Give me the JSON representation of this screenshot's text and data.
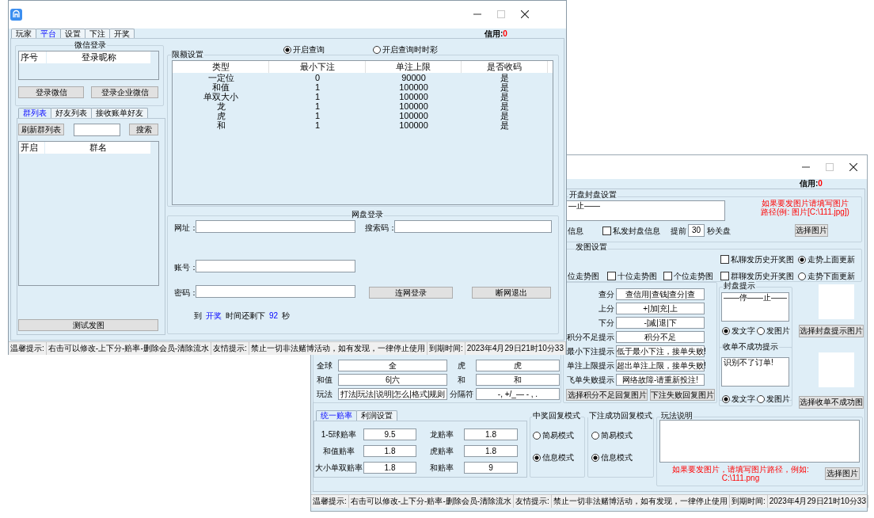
{
  "window_main": {
    "credit_label": "信用:",
    "credit_value": "0",
    "tabs": [
      {
        "label": "玩家",
        "selected": false
      },
      {
        "label": "平台",
        "selected": true
      },
      {
        "label": "设置",
        "selected": false
      },
      {
        "label": "下注",
        "selected": false
      },
      {
        "label": "开奖",
        "selected": false
      }
    ],
    "wechat_login": {
      "title": "微信登录",
      "columns": [
        "序号",
        "登录昵称"
      ],
      "buttons": [
        "登录微信",
        "登录企业微信"
      ]
    },
    "list_tabs": [
      {
        "label": "群列表",
        "selected": true
      },
      {
        "label": "好友列表",
        "selected": false
      },
      {
        "label": "接收账单好友",
        "selected": false
      }
    ],
    "group_list": {
      "refresh_button": "刷新群列表",
      "search_button": "搜索",
      "columns": [
        "开启",
        "群名"
      ],
      "test_button": "测试发图"
    },
    "query_options": [
      {
        "label": "开启查询",
        "selected": true
      },
      {
        "label": "开启查询时时彩",
        "selected": false
      }
    ],
    "limits": {
      "title": "限额设置",
      "columns": [
        "类型",
        "最小下注",
        "单注上限",
        "是否收码"
      ],
      "rows": [
        [
          "一定位",
          "0",
          "90000",
          "是"
        ],
        [
          "和值",
          "1",
          "100000",
          "是"
        ],
        [
          "单双大小",
          "1",
          "100000",
          "是"
        ],
        [
          "龙",
          "1",
          "100000",
          "是"
        ],
        [
          "虎",
          "1",
          "100000",
          "是"
        ],
        [
          "和",
          "1",
          "100000",
          "是"
        ]
      ]
    },
    "net_login": {
      "title": "网盘登录",
      "fields": [
        {
          "label": "网址："
        },
        {
          "label": "搜索码："
        },
        {
          "label": "账号："
        },
        {
          "label": "密码："
        }
      ],
      "buttons": [
        "连网登录",
        "断网退出"
      ],
      "countdown": [
        {
          "text": "到",
          "highlight": false
        },
        {
          "text": "开奖",
          "highlight": true
        },
        {
          "text": "时间还剩下",
          "highlight": false
        },
        {
          "text": "92",
          "highlight": true
        },
        {
          "text": "秒",
          "highlight": false
        }
      ]
    },
    "status_bar": [
      "温馨提示:",
      "右击可以修改-上下分-赔率-删除会员-清除流水",
      "友情提示:",
      "禁止一切非法赌博活动，如有发现，一律停止使用",
      "到期时间:",
      "2023年4月29日21时10分33"
    ]
  },
  "window_settings": {
    "credit_label": "信用:",
    "credit_value": "0",
    "close_settings": {
      "title": "开盘封盘设置",
      "message": "—止——",
      "fragment": "信息",
      "private_send": {
        "label": "私发封盘信息",
        "checked": false
      },
      "advance_label": "提前",
      "advance_value": "30",
      "advance_unit": "秒关盘",
      "image_hint_lines": [
        "如果要发图片请填写图片",
        "路径(例: 图片[C:\\111.jpg])"
      ],
      "image_button": "选择图片"
    },
    "image_settings": {
      "title": "发图设置",
      "fragment": "位走势图",
      "checkboxes": [
        {
          "label": "十位走势图",
          "checked": false
        },
        {
          "label": "个位走势图",
          "checked": false
        },
        {
          "label": "私聊发历史开奖图",
          "checked": false
        },
        {
          "label": "群聊发历史开奖图",
          "checked": false
        }
      ],
      "update_modes": [
        {
          "label": "走势上面更新",
          "selected": true
        },
        {
          "label": "走势下面更新",
          "selected": false
        }
      ]
    },
    "keywords": [
      {
        "label": "查分",
        "value": "查信用|查钱|查分|查"
      },
      {
        "label": "上分",
        "value": "+|加|充|上"
      },
      {
        "label": "下分",
        "value": "-|减|退|下"
      },
      {
        "label": "积分不足提示",
        "value": "积分不足"
      },
      {
        "label": "最小下注提示",
        "value": "低于最小下注，接单失败!"
      },
      {
        "label": "单注上限提示",
        "value": "超出单注上限，接单失败!"
      },
      {
        "label": "飞单失败提示",
        "value": "网络故障-请重新投注!"
      }
    ],
    "keyword_buttons": [
      "选择积分不足回复图片",
      "下注失败回复图片"
    ],
    "bet_keywords": [
      {
        "label": "全球",
        "value": "全",
        "label2": "虎",
        "value2": "虎"
      },
      {
        "label": "和值",
        "value": "6|六",
        "label2": "和",
        "value2": "和"
      },
      {
        "label": "玩法",
        "value": "打法|玩法|说明|怎么|格式|规则",
        "label2": "分隔符",
        "value2": "-, +/_— - , ."
      }
    ],
    "close_notice": {
      "title": "封盘提示",
      "message": "——停——止——",
      "modes": [
        {
          "label": "发文字",
          "selected": true
        },
        {
          "label": "发图片",
          "selected": false
        }
      ],
      "button": "选择封盘提示图片"
    },
    "fail_notice": {
      "title": "收单不成功提示",
      "message": "识别不了订单!",
      "modes": [
        {
          "label": "发文字",
          "selected": true
        },
        {
          "label": "发图片",
          "selected": false
        }
      ],
      "button": "选择收单不成功图"
    },
    "odds_tabs": [
      {
        "label": "统一赔率",
        "selected": true
      },
      {
        "label": "利润设置",
        "selected": false
      }
    ],
    "odds": [
      {
        "label": "1-5球赔率",
        "value": "9.5",
        "label2": "龙赔率",
        "value2": "1.8"
      },
      {
        "label": "和值赔率",
        "value": "1.8",
        "label2": "虎赔率",
        "value2": "1.8"
      },
      {
        "label": "大小单双赔率",
        "value": "1.8",
        "label2": "和赔率",
        "value2": "9"
      }
    ],
    "win_reply": {
      "title": "中奖回复模式",
      "modes": [
        {
          "label": "简易模式",
          "selected": false
        },
        {
          "label": "信息模式",
          "selected": true
        }
      ]
    },
    "bet_reply": {
      "title": "下注成功回复模式",
      "modes": [
        {
          "label": "简易模式",
          "selected": false
        },
        {
          "label": "信息模式",
          "selected": true
        }
      ]
    },
    "rules": {
      "title": "玩法说明",
      "hint": "如果要发图片，请填写图片路径，例如: C:\\111.png",
      "button": "选择图片"
    },
    "status_bar": [
      "温馨提示:",
      "右击可以修改-上下分-赔率-删除会员-清除流水",
      "友情提示:",
      "禁止一切非法赌博活动，如有发现，一律停止使用",
      "到期时间:",
      "2023年4月29日21时10分33"
    ]
  }
}
